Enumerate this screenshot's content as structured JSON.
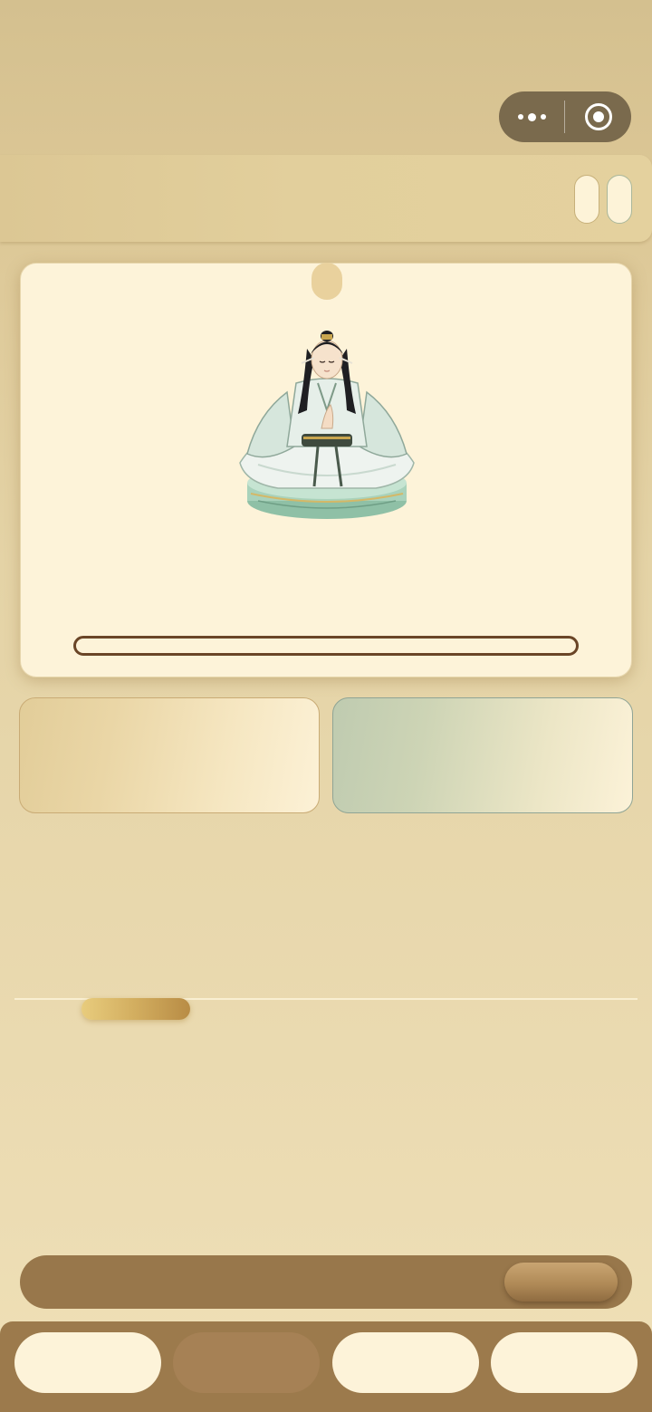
{
  "capsule": {
    "more_icon": "more-dots-icon",
    "close_icon": "target-circle-icon"
  },
  "main_card": {
    "figure": "seated-cultivator-figure",
    "progress": 0
  },
  "tabbar": {
    "active_index": 1
  },
  "colors": {
    "background": "#e4d3a6",
    "card": "#fdf3d9",
    "brown": "#98774b",
    "dark_brown": "#6a4527",
    "jade": "#bfcbb0",
    "gold": "#d2ad5f"
  }
}
